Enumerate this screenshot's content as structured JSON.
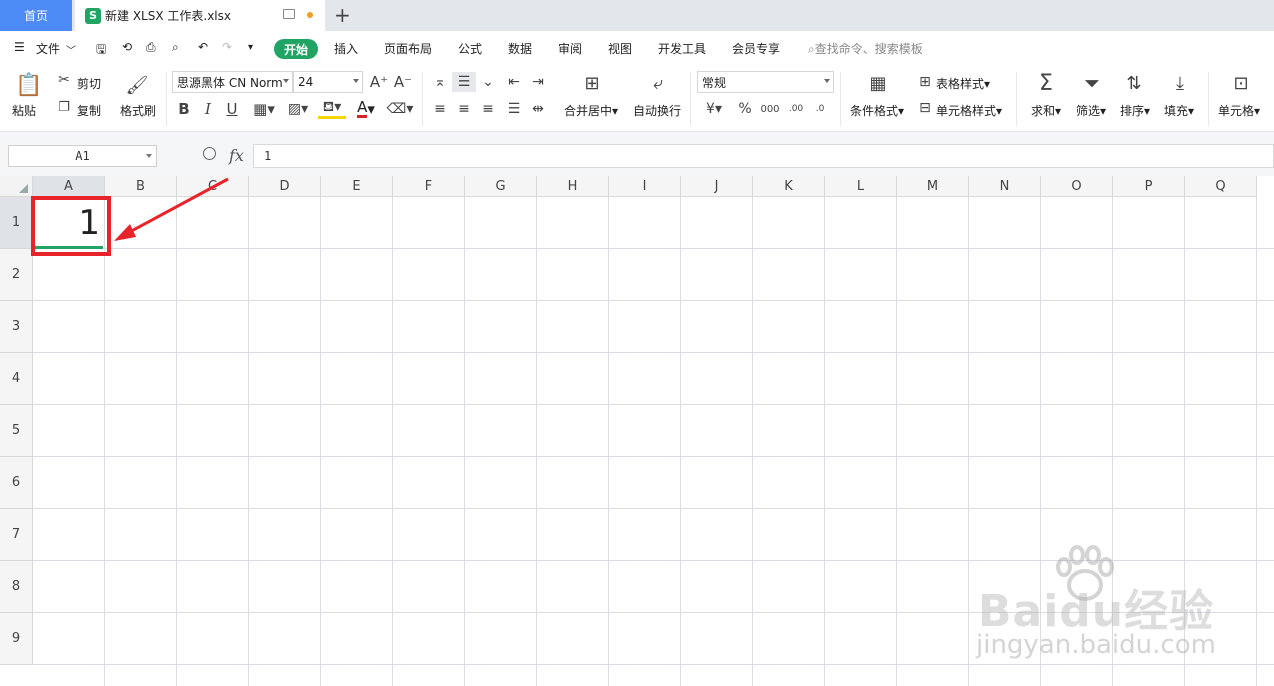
{
  "tabs": {
    "home": "首页",
    "document": "新建 XLSX 工作表.xlsx",
    "sheet_logo": "S"
  },
  "menu": {
    "file": "文件",
    "items": [
      "开始",
      "插入",
      "页面布局",
      "公式",
      "数据",
      "审阅",
      "视图",
      "开发工具",
      "会员专享"
    ],
    "search_placeholder": "查找命令、搜索模板"
  },
  "ribbon": {
    "paste": "粘贴",
    "cut": "剪切",
    "copy": "复制",
    "format_painter": "格式刷",
    "font_name": "思源黑体 CN Norm",
    "font_size": "24",
    "merge_center": "合并居中",
    "wrap_text": "自动换行",
    "number_format": "常规",
    "conditional_format": "条件格式",
    "table_style": "表格样式",
    "cell_style": "单元格样式",
    "sum": "求和",
    "filter": "筛选",
    "sort": "排序",
    "fill": "填充",
    "cell": "单元格"
  },
  "formula_bar": {
    "name_box": "A1",
    "fx_label": "fx",
    "value": "1"
  },
  "sheet": {
    "columns": [
      "A",
      "B",
      "C",
      "D",
      "E",
      "F",
      "G",
      "H",
      "I",
      "J",
      "K",
      "L",
      "M",
      "N",
      "O",
      "P",
      "Q"
    ],
    "rows": [
      "1",
      "2",
      "3",
      "4",
      "5",
      "6",
      "7",
      "8",
      "9"
    ],
    "selected_cell": "A1",
    "a1_value": "1"
  },
  "watermark": {
    "brand": "Baidu经验",
    "url": "jingyan.baidu.com"
  },
  "colors": {
    "accent": "#20a464",
    "home_tab": "#4c8bf5",
    "highlight": "#e8232a"
  }
}
